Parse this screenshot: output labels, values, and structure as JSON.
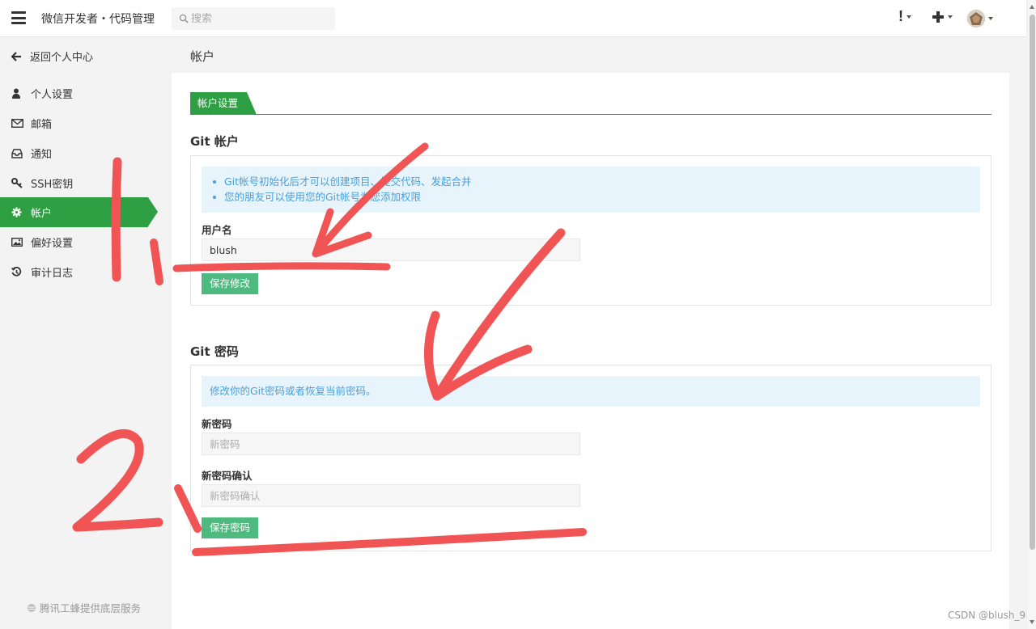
{
  "header": {
    "app_title": "微信开发者・代码管理",
    "search_placeholder": "搜索",
    "alerts_label": "!"
  },
  "sidebar": {
    "back_label": "返回个人中心",
    "items": [
      {
        "label": "个人设置",
        "icon": "user-icon",
        "active": false
      },
      {
        "label": "邮箱",
        "icon": "envelope-icon",
        "active": false
      },
      {
        "label": "通知",
        "icon": "inbox-icon",
        "active": false
      },
      {
        "label": "SSH密钥",
        "icon": "key-icon",
        "active": false
      },
      {
        "label": "帐户",
        "icon": "gear-icon",
        "active": true
      },
      {
        "label": "偏好设置",
        "icon": "image-icon",
        "active": false
      },
      {
        "label": "审计日志",
        "icon": "history-icon",
        "active": false
      }
    ],
    "footer": "腾讯工蜂提供底层服务"
  },
  "main": {
    "page_title": "帐户",
    "tab_label": "帐户设置",
    "git_account": {
      "title": "Git 帐户",
      "notes": [
        "Git帐号初始化后才可以创建项目、提交代码、发起合并",
        "您的朋友可以使用您的Git帐号为您添加权限"
      ],
      "username_label": "用户名",
      "username_value": "blush",
      "save_label": "保存修改"
    },
    "git_password": {
      "title": "Git 密码",
      "note": "修改你的Git密码或者恢复当前密码。",
      "new_password_label": "新密码",
      "new_password_placeholder": "新密码",
      "confirm_label": "新密码确认",
      "confirm_placeholder": "新密码确认",
      "save_label": "保存密码"
    }
  },
  "watermark": "CSDN @blush_9",
  "colors": {
    "accent": "#2ea043",
    "button": "#4fba7f",
    "info_text": "#4a9fd8",
    "info_bg": "#e8f4fc",
    "annotation": "#f05454"
  }
}
